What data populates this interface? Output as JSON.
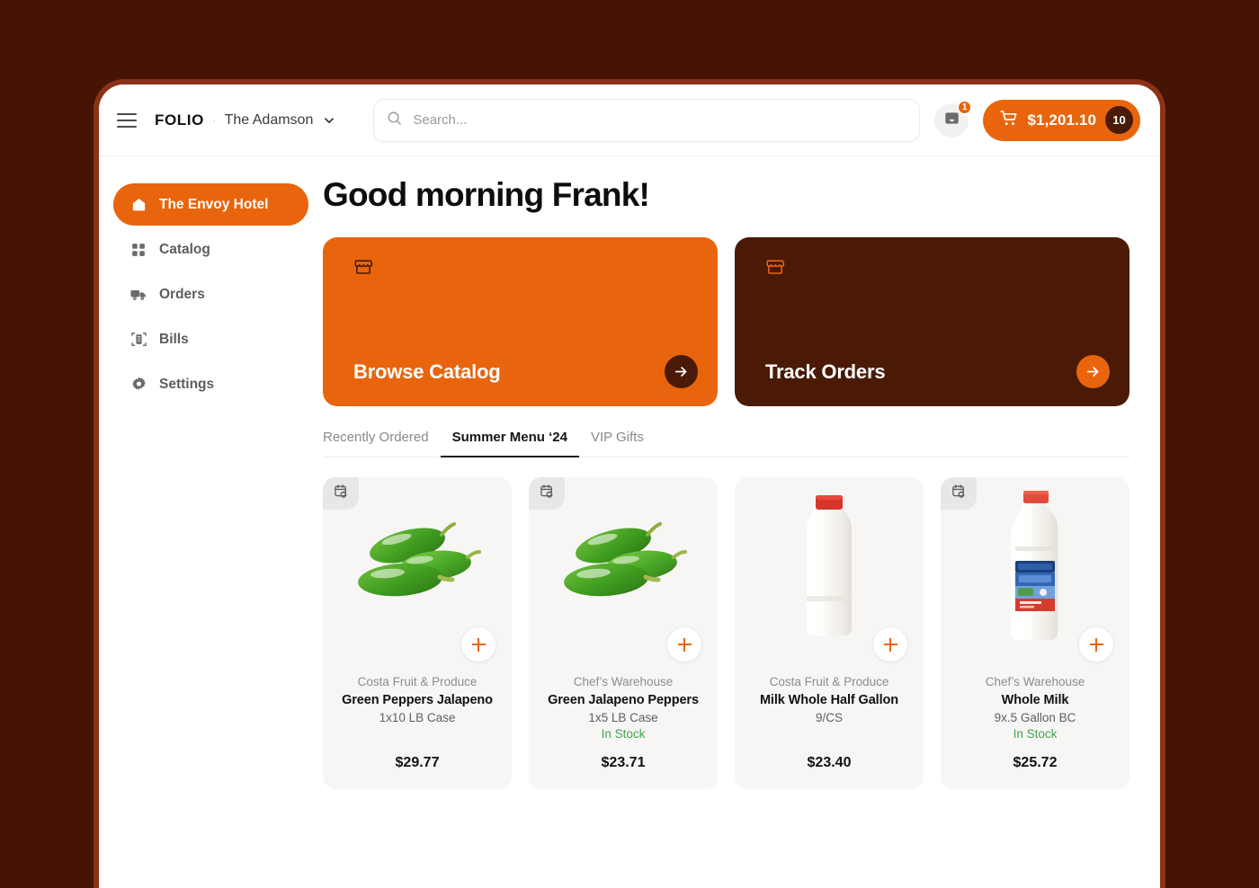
{
  "theme": {
    "page_background": "#451405",
    "window_border": "#8a3317",
    "accent_orange": "#E8650D",
    "dark_brown": "#4A1A07",
    "in_stock_green": "#3FA34D"
  },
  "topbar": {
    "menu_icon": "hamburger-icon",
    "brand": "FOLIO",
    "separator": "·",
    "account": "The Adamson",
    "account_chevron_icon": "chevron-down-icon",
    "search": {
      "icon": "search-icon",
      "placeholder": "Search...",
      "value": ""
    },
    "inbox": {
      "icon": "inbox-icon",
      "badge": "1"
    },
    "cart": {
      "icon": "shopping-cart-icon",
      "total": "$1,201.10",
      "count": "10"
    }
  },
  "sidebar": {
    "items": [
      {
        "label": "The Envoy Hotel",
        "icon": "home-icon",
        "active": true
      },
      {
        "label": "Catalog",
        "icon": "grid-icon",
        "active": false
      },
      {
        "label": "Orders",
        "icon": "truck-icon",
        "active": false
      },
      {
        "label": "Bills",
        "icon": "receipt-icon",
        "active": false
      },
      {
        "label": "Settings",
        "icon": "gear-icon",
        "active": false
      }
    ]
  },
  "main": {
    "greeting": "Good morning Frank!",
    "hero_cards": [
      {
        "title": "Browse Catalog",
        "icon": "storefront-icon",
        "arrow_icon": "arrow-right-icon",
        "style": "orange"
      },
      {
        "title": "Track Orders",
        "icon": "storefront-icon",
        "arrow_icon": "arrow-right-icon",
        "style": "dark"
      }
    ],
    "tabs": [
      {
        "label": "Recently Ordered",
        "active": false
      },
      {
        "label": "Summer Menu ‘24",
        "active": true
      },
      {
        "label": "VIP Gifts",
        "active": false
      }
    ],
    "products": [
      {
        "vendor": "Costa Fruit & Produce",
        "name": "Green Peppers Jalapeno",
        "pack": "1x10 LB Case",
        "stock": "",
        "price": "$29.77",
        "image": "jalapeno-peppers-image",
        "reorder_badge": true,
        "add_icon": "plus-icon"
      },
      {
        "vendor": "Chef’s Warehouse",
        "name": "Green Jalapeno Peppers",
        "pack": "1x5 LB Case",
        "stock": "In Stock",
        "price": "$23.71",
        "image": "jalapeno-peppers-image",
        "reorder_badge": true,
        "add_icon": "plus-icon"
      },
      {
        "vendor": "Costa Fruit & Produce",
        "name": "Milk Whole Half Gallon",
        "pack": "9/CS",
        "stock": "",
        "price": "$23.40",
        "image": "milk-jug-plain-image",
        "reorder_badge": false,
        "add_icon": "plus-icon"
      },
      {
        "vendor": "Chef’s Warehouse",
        "name": "Whole Milk",
        "pack": "9x.5 Gallon BC",
        "stock": "In Stock",
        "price": "$25.72",
        "image": "milk-jug-labeled-image",
        "reorder_badge": true,
        "add_icon": "plus-icon"
      }
    ]
  }
}
